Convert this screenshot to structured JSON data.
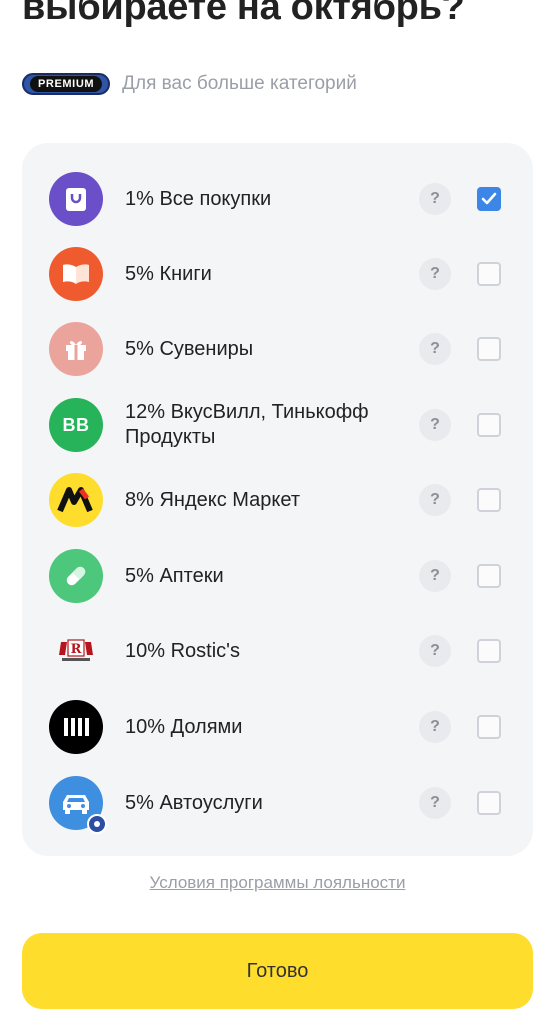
{
  "header": {
    "title": "выбираете на октябрь?",
    "premium_badge": "PREMIUM",
    "premium_text": "Для вас больше категорий"
  },
  "categories": [
    {
      "label": "1% Все покупки",
      "icon": "shopping-bag-icon",
      "color": "#6a4fc9",
      "checked": true
    },
    {
      "label": "5% Книги",
      "icon": "open-book-icon",
      "color": "#ef5b2f",
      "checked": false
    },
    {
      "label": "5% Сувениры",
      "icon": "gift-icon",
      "color": "#eba49b",
      "checked": false
    },
    {
      "label": "12% ВкусВилл, Тинькофф Продукты",
      "icon": "vkusvill-logo",
      "logo_text": "BB",
      "color": "#27b35a",
      "checked": false
    },
    {
      "label": "8% Яндекс Маркет",
      "icon": "yandex-market-logo",
      "color": "#ffdd2d",
      "checked": false
    },
    {
      "label": "5% Аптеки",
      "icon": "pill-icon",
      "color": "#4cc77b",
      "checked": false
    },
    {
      "label": "10% Rostic's",
      "icon": "rostics-logo",
      "color": "#b5161e",
      "checked": false
    },
    {
      "label": "10% Долями",
      "icon": "dolyami-logo",
      "color": "#000000",
      "checked": false
    },
    {
      "label": "5% Автоуслуги",
      "icon": "car-icon",
      "color": "#3f8fe0",
      "checked": false
    }
  ],
  "help_symbol": "?",
  "footer": {
    "terms_link": "Условия программы лояльности",
    "done_button": "Готово"
  },
  "colors": {
    "accent_yellow": "#ffdd2d",
    "checkbox_blue": "#3b86e6",
    "card_bg": "#f4f5f7"
  }
}
